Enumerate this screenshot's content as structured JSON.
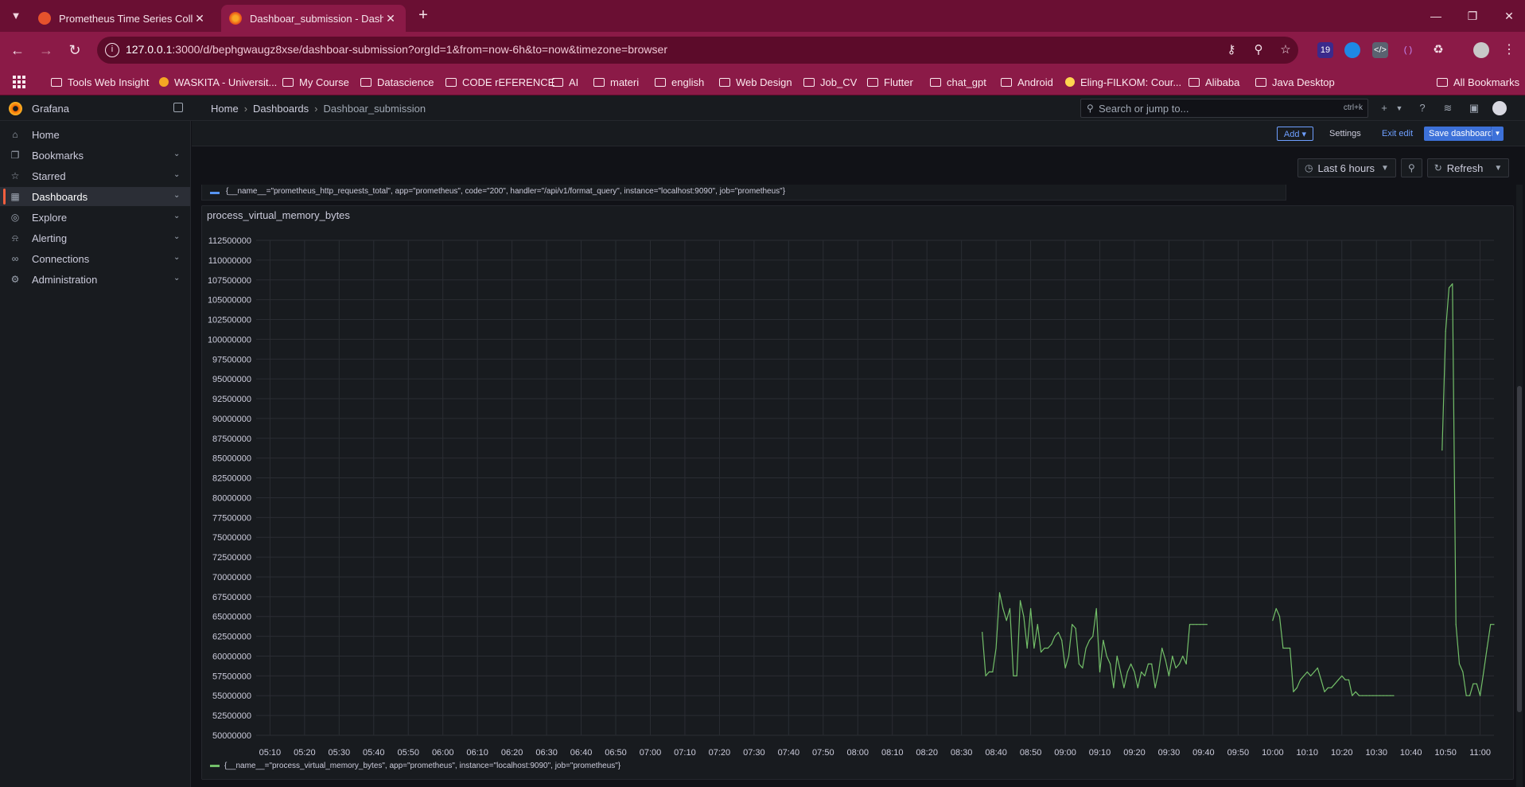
{
  "browser": {
    "tabs": [
      {
        "title": "Prometheus Time Series Collect",
        "active": false
      },
      {
        "title": "Dashboar_submission - Dashbo",
        "active": true
      }
    ],
    "url_host": "127.0.0.1",
    "url_rest": ":3000/d/bephgwaugz8xse/dashboar-submission?orgId=1&from=now-6h&to=now&timezone=browser",
    "extension_badge": "19",
    "bookmarks": [
      {
        "label": "Tools Web Insight",
        "kind": "folder"
      },
      {
        "label": "WASKITA - Universit...",
        "kind": "site"
      },
      {
        "label": "My Course",
        "kind": "folder"
      },
      {
        "label": "Datascience",
        "kind": "folder"
      },
      {
        "label": "CODE rEFERENCE",
        "kind": "folder"
      },
      {
        "label": "AI",
        "kind": "folder"
      },
      {
        "label": "materi",
        "kind": "folder"
      },
      {
        "label": "english",
        "kind": "folder"
      },
      {
        "label": "Web Design",
        "kind": "folder"
      },
      {
        "label": "Job_CV",
        "kind": "folder"
      },
      {
        "label": "Flutter",
        "kind": "folder"
      },
      {
        "label": "chat_gpt",
        "kind": "folder"
      },
      {
        "label": "Android",
        "kind": "folder"
      },
      {
        "label": "Eling-FILKOM: Cour...",
        "kind": "site"
      },
      {
        "label": "Alibaba",
        "kind": "folder"
      },
      {
        "label": "Java Desktop",
        "kind": "folder"
      }
    ],
    "all_bookmarks": "All Bookmarks"
  },
  "grafana": {
    "app_name": "Grafana",
    "breadcrumbs": [
      "Home",
      "Dashboards",
      "Dashboar_submission"
    ],
    "search_placeholder": "Search or jump to...",
    "search_shortcut": "ctrl+k",
    "nav": [
      {
        "label": "Home",
        "icon": "home-icon",
        "chevron": false,
        "active": false
      },
      {
        "label": "Bookmarks",
        "icon": "bookmark-icon",
        "chevron": true,
        "active": false
      },
      {
        "label": "Starred",
        "icon": "star-icon",
        "chevron": true,
        "active": false
      },
      {
        "label": "Dashboards",
        "icon": "apps-icon",
        "chevron": true,
        "active": true
      },
      {
        "label": "Explore",
        "icon": "compass-icon",
        "chevron": true,
        "active": false
      },
      {
        "label": "Alerting",
        "icon": "bell-icon",
        "chevron": true,
        "active": false
      },
      {
        "label": "Connections",
        "icon": "link-icon",
        "chevron": true,
        "active": false
      },
      {
        "label": "Administration",
        "icon": "cog-icon",
        "chevron": true,
        "active": false
      }
    ],
    "toolbar": {
      "add": "Add",
      "settings": "Settings",
      "exit_edit": "Exit edit",
      "save": "Save dashboard"
    },
    "time_range": "Last 6 hours",
    "refresh": "Refresh",
    "previous_panel_legend": "{__name__=\"prometheus_http_requests_total\", app=\"prometheus\", code=\"200\", handler=\"/api/v1/format_query\", instance=\"localhost:9090\", job=\"prometheus\"}",
    "panel": {
      "title": "process_virtual_memory_bytes",
      "legend": "{__name__=\"process_virtual_memory_bytes\", app=\"prometheus\", instance=\"localhost:9090\", job=\"prometheus\"}"
    }
  },
  "colors": {
    "series": "#73bf69",
    "accent": "#3d71d9",
    "brand": "#f46800"
  },
  "chart_data": {
    "type": "line",
    "title": "process_virtual_memory_bytes",
    "ylim": [
      50000000,
      112500000
    ],
    "y_ticks": [
      "112500000",
      "110000000",
      "107500000",
      "105000000",
      "102500000",
      "100000000",
      "97500000",
      "95000000",
      "92500000",
      "90000000",
      "87500000",
      "85000000",
      "82500000",
      "80000000",
      "77500000",
      "75000000",
      "72500000",
      "70000000",
      "67500000",
      "65000000",
      "62500000",
      "60000000",
      "57500000",
      "55000000",
      "52500000",
      "50000000"
    ],
    "x_ticks": [
      "05:10",
      "05:20",
      "05:30",
      "05:40",
      "05:50",
      "06:00",
      "06:10",
      "06:20",
      "06:30",
      "06:40",
      "06:50",
      "07:00",
      "07:10",
      "07:20",
      "07:30",
      "07:40",
      "07:50",
      "08:00",
      "08:10",
      "08:20",
      "08:30",
      "08:40",
      "08:50",
      "09:00",
      "09:10",
      "09:20",
      "09:30",
      "09:40",
      "09:50",
      "10:00",
      "10:10",
      "10:20",
      "10:30",
      "10:40",
      "10:50",
      "11:00"
    ],
    "x_range": [
      "05:10",
      "11:04"
    ],
    "grid": true,
    "legend_position": "bottom-left",
    "series": [
      {
        "name": "{__name__=\"process_virtual_memory_bytes\", app=\"prometheus\", instance=\"localhost:9090\", job=\"prometheus\"}",
        "segments": [
          [
            [
              "08:36",
              63000000
            ],
            [
              "08:37",
              57500000
            ],
            [
              "08:38",
              58000000
            ],
            [
              "08:39",
              58000000
            ],
            [
              "08:40",
              61000000
            ],
            [
              "08:41",
              68000000
            ],
            [
              "08:42",
              66000000
            ],
            [
              "08:43",
              64500000
            ],
            [
              "08:44",
              66000000
            ],
            [
              "08:45",
              57500000
            ],
            [
              "08:46",
              57500000
            ],
            [
              "08:47",
              67000000
            ],
            [
              "08:48",
              65000000
            ],
            [
              "08:49",
              61000000
            ],
            [
              "08:50",
              66000000
            ],
            [
              "08:51",
              61000000
            ],
            [
              "08:52",
              64000000
            ],
            [
              "08:53",
              60500000
            ],
            [
              "08:54",
              61000000
            ],
            [
              "08:55",
              61000000
            ],
            [
              "08:56",
              61500000
            ],
            [
              "08:57",
              62500000
            ],
            [
              "08:58",
              63000000
            ],
            [
              "08:59",
              62000000
            ],
            [
              "09:00",
              58500000
            ],
            [
              "09:01",
              60000000
            ],
            [
              "09:02",
              64000000
            ],
            [
              "09:03",
              63500000
            ],
            [
              "09:04",
              59000000
            ],
            [
              "09:05",
              58500000
            ],
            [
              "09:06",
              61000000
            ],
            [
              "09:07",
              62000000
            ],
            [
              "09:08",
              62500000
            ],
            [
              "09:09",
              66000000
            ],
            [
              "09:10",
              58000000
            ],
            [
              "09:11",
              62000000
            ],
            [
              "09:12",
              60000000
            ],
            [
              "09:13",
              59000000
            ],
            [
              "09:14",
              56000000
            ],
            [
              "09:15",
              60000000
            ],
            [
              "09:16",
              58000000
            ],
            [
              "09:17",
              56000000
            ],
            [
              "09:18",
              58000000
            ],
            [
              "09:19",
              59000000
            ],
            [
              "09:20",
              58000000
            ],
            [
              "09:21",
              56000000
            ],
            [
              "09:22",
              58000000
            ],
            [
              "09:23",
              57500000
            ],
            [
              "09:24",
              59000000
            ],
            [
              "09:25",
              59000000
            ],
            [
              "09:26",
              56000000
            ],
            [
              "09:27",
              58000000
            ],
            [
              "09:28",
              61000000
            ],
            [
              "09:29",
              59500000
            ],
            [
              "09:30",
              57500000
            ],
            [
              "09:31",
              60000000
            ],
            [
              "09:32",
              58500000
            ],
            [
              "09:33",
              59000000
            ],
            [
              "09:34",
              60000000
            ],
            [
              "09:35",
              59000000
            ],
            [
              "09:36",
              64000000
            ],
            [
              "09:37",
              64000000
            ],
            [
              "09:38",
              64000000
            ],
            [
              "09:39",
              64000000
            ],
            [
              "09:40",
              64000000
            ],
            [
              "09:41",
              64000000
            ]
          ],
          [
            [
              "10:00",
              64500000
            ],
            [
              "10:01",
              66000000
            ],
            [
              "10:02",
              65000000
            ],
            [
              "10:03",
              61000000
            ],
            [
              "10:04",
              61000000
            ],
            [
              "10:05",
              61000000
            ],
            [
              "10:06",
              55500000
            ],
            [
              "10:07",
              56000000
            ],
            [
              "10:08",
              57000000
            ],
            [
              "10:09",
              57500000
            ],
            [
              "10:10",
              58000000
            ],
            [
              "10:11",
              57500000
            ],
            [
              "10:12",
              58000000
            ],
            [
              "10:13",
              58500000
            ],
            [
              "10:14",
              57000000
            ],
            [
              "10:15",
              55500000
            ],
            [
              "10:16",
              56000000
            ],
            [
              "10:17",
              56000000
            ],
            [
              "10:18",
              56500000
            ],
            [
              "10:19",
              57000000
            ],
            [
              "10:20",
              57500000
            ],
            [
              "10:21",
              57000000
            ],
            [
              "10:22",
              57000000
            ],
            [
              "10:23",
              55000000
            ],
            [
              "10:24",
              55500000
            ],
            [
              "10:25",
              55000000
            ],
            [
              "10:26",
              55000000
            ],
            [
              "10:27",
              55000000
            ],
            [
              "10:28",
              55000000
            ],
            [
              "10:29",
              55000000
            ],
            [
              "10:30",
              55000000
            ],
            [
              "10:31",
              55000000
            ],
            [
              "10:32",
              55000000
            ],
            [
              "10:33",
              55000000
            ],
            [
              "10:34",
              55000000
            ],
            [
              "10:35",
              55000000
            ]
          ],
          [
            [
              "10:49",
              86000000
            ],
            [
              "10:50",
              101000000
            ],
            [
              "10:51",
              106500000
            ],
            [
              "10:52",
              107000000
            ],
            [
              "10:53",
              64000000
            ],
            [
              "10:54",
              59000000
            ],
            [
              "10:55",
              58000000
            ],
            [
              "10:56",
              55000000
            ],
            [
              "10:57",
              55000000
            ],
            [
              "10:58",
              56500000
            ],
            [
              "10:59",
              56500000
            ],
            [
              "11:00",
              55000000
            ],
            [
              "11:01",
              58000000
            ],
            [
              "11:02",
              61000000
            ],
            [
              "11:03",
              64000000
            ],
            [
              "11:04",
              64000000
            ]
          ]
        ]
      }
    ]
  }
}
